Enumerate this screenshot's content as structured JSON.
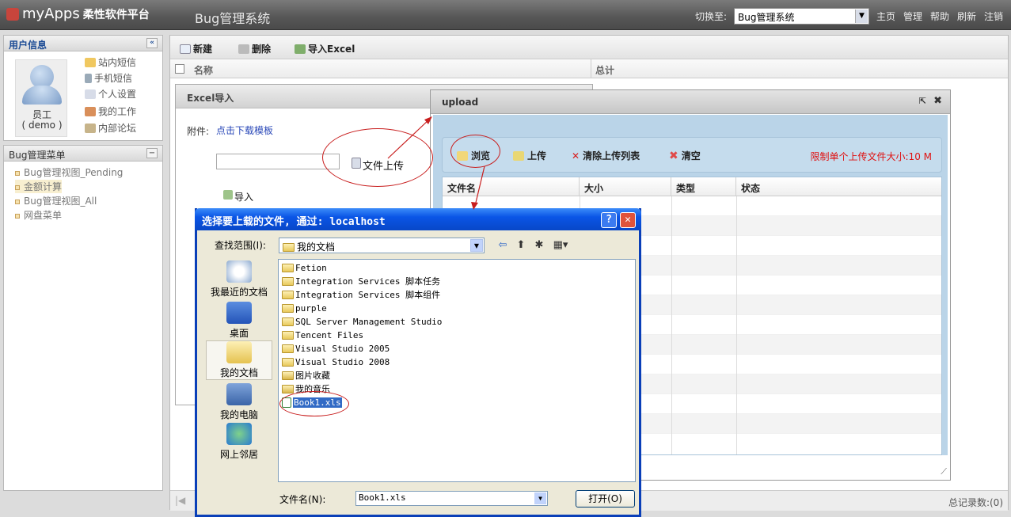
{
  "header": {
    "logo_text": "myApps",
    "logo_sub": "柔性软件平台",
    "system_title": "Bug管理系统",
    "switch_label": "切换至:",
    "switch_value": "Bug管理系统",
    "links": [
      "主页",
      "管理",
      "帮助",
      "刷新",
      "注销"
    ]
  },
  "user_panel": {
    "title": "用户信息",
    "name": "员工",
    "username": "( demo )",
    "menu": [
      "站内短信",
      "手机短信",
      "个人设置",
      "我的工作",
      "内部论坛"
    ]
  },
  "bug_menu": {
    "title": "Bug管理菜单",
    "items": [
      "Bug管理视图_Pending",
      "金额计算",
      "Bug管理视图_All",
      "网盘菜单"
    ]
  },
  "toolbar": {
    "new": "新建",
    "delete": "删除",
    "import": "导入Excel"
  },
  "grid": {
    "columns": [
      "名称",
      "总计"
    ],
    "footer_total": "总记录数:(0)"
  },
  "excel_import": {
    "title": "Excel导入",
    "attach_label": "附件:",
    "download_link": "点击下载模板",
    "file_upload": "文件上传",
    "import_button": "导入"
  },
  "upload": {
    "title": "upload",
    "buttons": {
      "browse": "浏览",
      "upload": "上传",
      "clear_list": "清除上传列表",
      "clear": "清空"
    },
    "limit_text": "限制单个上传文件大小:10 M",
    "columns": [
      "文件名",
      "大小",
      "类型",
      "状态"
    ]
  },
  "file_dialog": {
    "title": "选择要上载的文件, 通过: localhost",
    "look_in_label": "查找范围(I):",
    "look_in_value": "我的文档",
    "places": [
      "我最近的文档",
      "桌面",
      "我的文档",
      "我的电脑",
      "网上邻居"
    ],
    "files": [
      "Fetion",
      "Integration Services 脚本任务",
      "Integration Services 脚本组件",
      "purple",
      "SQL Server Management Studio",
      "Tencent Files",
      "Visual Studio 2005",
      "Visual Studio 2008",
      "图片收藏",
      "我的音乐",
      "Book1.xls"
    ],
    "filename_label": "文件名(N):",
    "filename_value": "Book1.xls",
    "open_button": "打开(O)",
    "help_button": "?",
    "close_button": "✕"
  },
  "colors": {
    "accent": "#c81e1e",
    "dialog_blue": "#0a55e6"
  }
}
